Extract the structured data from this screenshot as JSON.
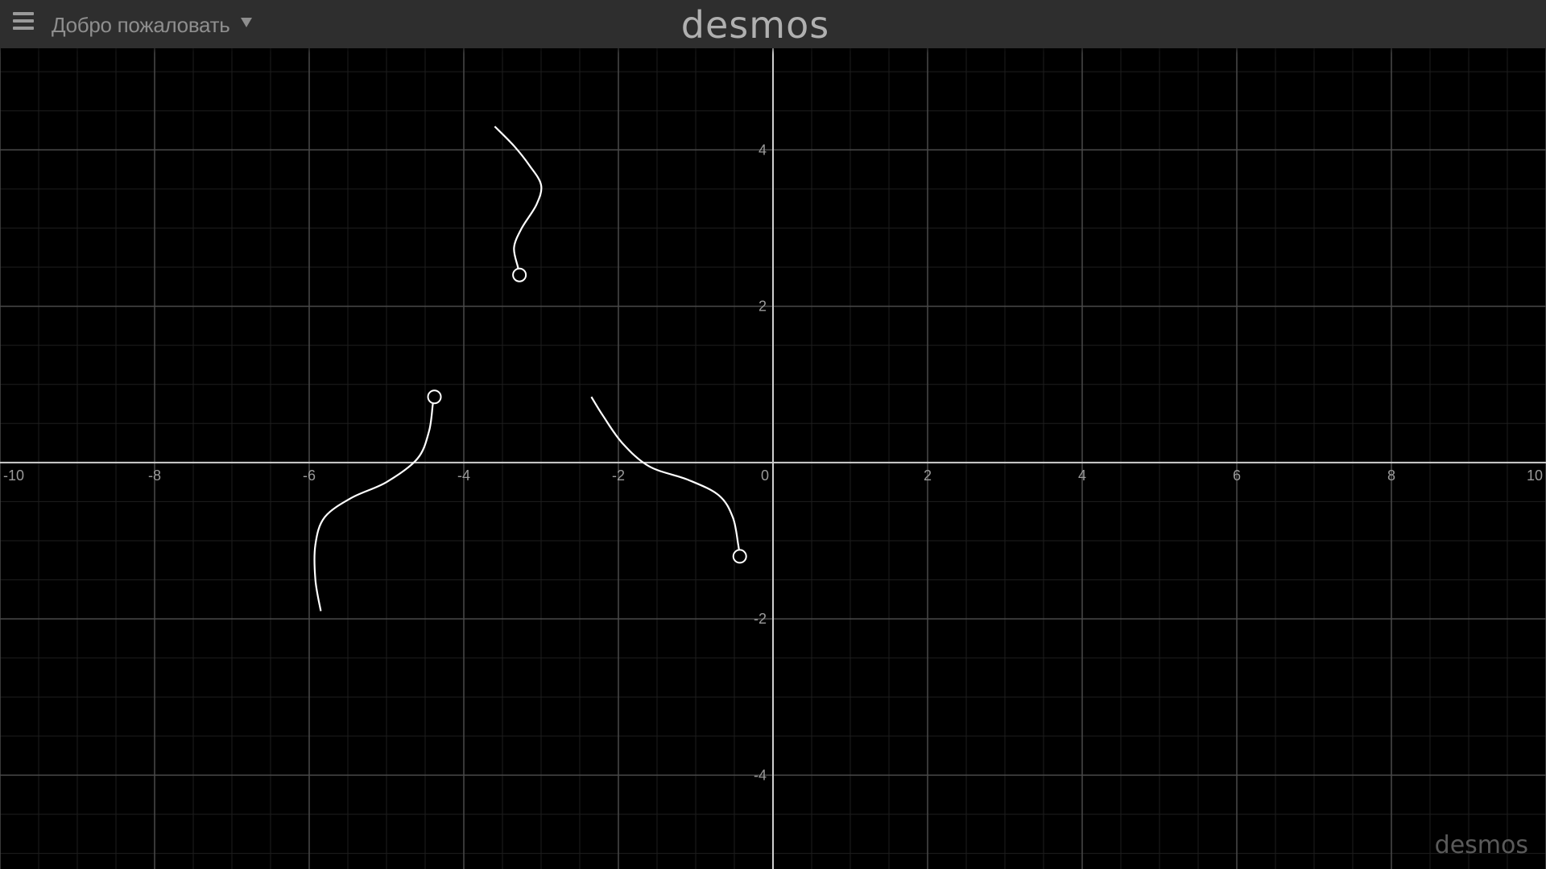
{
  "header": {
    "menu_icon": "hamburger-menu-icon",
    "graph_title": "Добро пожаловать",
    "title_caret_icon": "caret-down-icon",
    "brand": "desmos"
  },
  "watermark": {
    "tagline": "",
    "brand": "desmos"
  },
  "colors": {
    "header_bg": "#2e2e2e",
    "graph_bg": "#000000",
    "grid_minor": "#1e1e1e",
    "grid_major": "#4a4a4a",
    "axis": "#cfcfcf",
    "curve": "#ffffff"
  },
  "chart_data": {
    "type": "line",
    "title": "",
    "xlabel": "",
    "ylabel": "",
    "xlim": [
      -10,
      10
    ],
    "ylim": [
      -5.2,
      5.3
    ],
    "grid": true,
    "x_ticks": [
      -10,
      -8,
      -6,
      -4,
      -2,
      0,
      2,
      4,
      6,
      8,
      10
    ],
    "x_tick_labels": [
      "-10",
      "-8",
      "-6",
      "-4",
      "-2",
      "0",
      "2",
      "4",
      "6",
      "8",
      "10"
    ],
    "y_ticks": [
      4,
      2,
      -2,
      -4
    ],
    "y_tick_labels": [
      "4",
      "2",
      "-2",
      "-4"
    ],
    "series": [
      {
        "points": [
          [
            -3.6,
            4.3
          ],
          [
            -3.35,
            4.05
          ],
          [
            -3.15,
            3.8
          ],
          [
            -3.0,
            3.55
          ],
          [
            -3.06,
            3.3
          ],
          [
            -3.25,
            3.0
          ],
          [
            -3.35,
            2.75
          ],
          [
            -3.3,
            2.5
          ],
          [
            -3.28,
            2.4
          ]
        ],
        "open_end": true
      },
      {
        "points": [
          [
            -5.85,
            -1.9
          ],
          [
            -5.92,
            -1.5
          ],
          [
            -5.92,
            -1.05
          ],
          [
            -5.8,
            -0.7
          ],
          [
            -5.45,
            -0.45
          ],
          [
            -5.0,
            -0.25
          ],
          [
            -4.6,
            0.05
          ],
          [
            -4.45,
            0.4
          ],
          [
            -4.4,
            0.75
          ],
          [
            -4.38,
            0.84
          ]
        ],
        "open_end": true
      },
      {
        "points": [
          [
            -2.35,
            0.84
          ],
          [
            -2.2,
            0.6
          ],
          [
            -1.95,
            0.25
          ],
          [
            -1.6,
            -0.05
          ],
          [
            -1.1,
            -0.22
          ],
          [
            -0.7,
            -0.42
          ],
          [
            -0.52,
            -0.7
          ],
          [
            -0.45,
            -1.05
          ],
          [
            -0.43,
            -1.2
          ]
        ],
        "open_end": true
      }
    ]
  }
}
